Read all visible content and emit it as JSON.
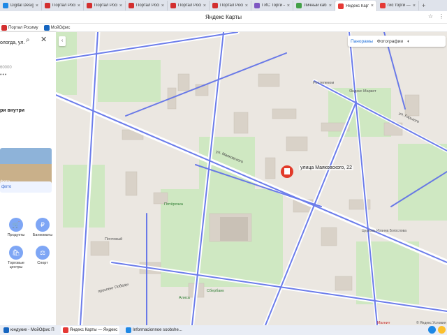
{
  "browser": {
    "tabs": [
      {
        "label": "Digital Design",
        "color": "#1e88e5",
        "active": false
      },
      {
        "label": "Портал Росим",
        "color": "#d32f2f",
        "active": false
      },
      {
        "label": "Портал Росиму",
        "color": "#d32f2f",
        "active": false
      },
      {
        "label": "Портал Росим",
        "color": "#d32f2f",
        "active": false
      },
      {
        "label": "Портал Росим",
        "color": "#d32f2f",
        "active": false
      },
      {
        "label": "Портал Росим",
        "color": "#d32f2f",
        "active": false
      },
      {
        "label": "ГИС Торги – п",
        "color": "#7e57c2",
        "active": false
      },
      {
        "label": "Личный кабин",
        "color": "#43a047",
        "active": false
      },
      {
        "label": "Яндекс Карт",
        "color": "#e53935",
        "active": true
      },
      {
        "label": "гис торги — Ян",
        "color": "#e53935",
        "active": false
      }
    ],
    "new_tab": "+",
    "page_title": "Яндекс Карты",
    "bookmarks": [
      {
        "label": "Портал Росиму",
        "color": "#d32f2f"
      },
      {
        "label": "МойОфис",
        "color": "#1565c0"
      }
    ]
  },
  "panel": {
    "search_text": "ологда, ул.",
    "postal": "60000",
    "dots": "•••",
    "inside_label": "ри внутри",
    "photo_label": "фото",
    "photo_link": "фото",
    "categories": [
      {
        "label": "Продукты",
        "icon": "cart-icon",
        "symbol": "🛒"
      },
      {
        "label": "Банкоматы",
        "icon": "ruble-icon",
        "symbol": "₽"
      },
      {
        "label": "Торговые центры",
        "icon": "bag-icon",
        "symbol": "🛍"
      },
      {
        "label": "Спорт",
        "icon": "dumbbell-icon",
        "symbol": "⚖"
      }
    ]
  },
  "map": {
    "controls": {
      "panoramas": "Панорамы",
      "photos": "Фотографии"
    },
    "pin_label": "улица Маяковского, 22",
    "footer": "© Яндекс  Условия",
    "places": [
      {
        "text": "Ростелеком"
      },
      {
        "text": "Яндекс Маркет"
      },
      {
        "text": "Пятёрочка"
      },
      {
        "text": "Почтовый"
      },
      {
        "text": "Сбербанк"
      },
      {
        "text": "Церковь Иоанна Богослова"
      },
      {
        "text": "Магнит"
      },
      {
        "text": "Алиса"
      }
    ],
    "streets": [
      {
        "text": "ул. Маяковского"
      },
      {
        "text": "проспект Победы"
      },
      {
        "text": "ул. Горького"
      }
    ]
  },
  "taskbar": {
    "items": [
      {
        "label": "юндукие - МойОфис П",
        "color": "#1565c0",
        "active": false
      },
      {
        "label": "Яндекс Карты — Яндекс",
        "color": "#e53935",
        "active": true
      },
      {
        "label": "Informacionnoe soobshe...",
        "color": "#1e88e5",
        "active": false
      }
    ]
  }
}
